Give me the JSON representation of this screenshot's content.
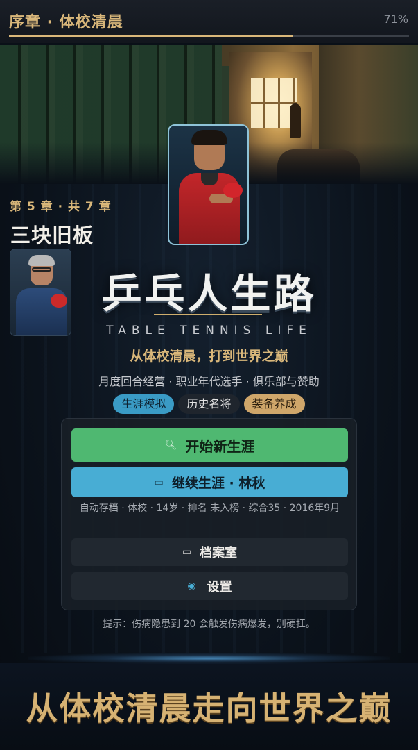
{
  "header": {
    "chapter_title": "序章 · 体校清晨",
    "progress_text": "71%",
    "progress_value": 0.71
  },
  "story": {
    "chapter_count": "第 5 章 · 共 7 章",
    "chapter_name": "三块旧板"
  },
  "game": {
    "logo": "乒乓人生路",
    "english_title": "TABLE TENNIS LIFE",
    "tagline": "从体校清晨，打到世界之巅",
    "features": "月度回合经营 · 职业年代选手 · 俱乐部与赞助",
    "tags": [
      "生涯模拟",
      "历史名将",
      "装备养成"
    ]
  },
  "menu": {
    "new_career": "开始新生涯",
    "continue_career": "继续生涯 · 林秋",
    "save_info": "自动存档 · 体校 · 14岁 · 排名 未入榜 · 综合35 · 2016年9月",
    "archive": "档案室",
    "settings": "设置"
  },
  "hint": "提示：伤病隐患到 20 会触发伤病爆发，别硬扛。",
  "slogan": "从体校清晨走向世界之巅",
  "icons": {
    "new_career": "search-icon",
    "continue_career": "folder-icon",
    "archive": "archive-folder-icon",
    "settings": "dot-icon"
  },
  "colors": {
    "gold_accent": "#d9b77a",
    "green_button": "#4fb871",
    "blue_button": "#48add4",
    "background": "#0a1018"
  }
}
